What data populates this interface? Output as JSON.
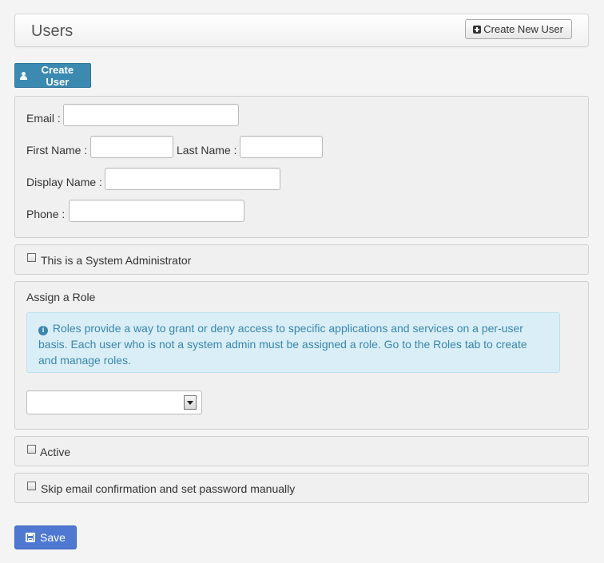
{
  "header": {
    "title": "Users",
    "create_new_label": "Create New User"
  },
  "create_user_label": "Create User",
  "form": {
    "email_label": "Email :",
    "email_value": "",
    "first_name_label": "First Name :",
    "first_name_value": "",
    "last_name_label": "Last Name :",
    "last_name_value": "",
    "display_name_label": "Display Name :",
    "display_name_value": "",
    "phone_label": "Phone :",
    "phone_value": ""
  },
  "system_admin": {
    "label": "This is a System Administrator",
    "checked": false
  },
  "role": {
    "title": "Assign a Role",
    "info_text": "Roles provide a way to grant or deny access to specific applications and services on a per-user basis. Each user who is not a system admin must be assigned a role. Go to the Roles tab to create and manage roles.",
    "selected": ""
  },
  "active": {
    "label": "Active",
    "checked": false
  },
  "skip_email": {
    "label": "Skip email confirmation and set password manually",
    "checked": false
  },
  "save_label": "Save",
  "colors": {
    "create_user_btn": "#3a8ab2",
    "save_btn": "#4e78d2",
    "info_bg": "#d9eef6",
    "info_text": "#3a87ad"
  }
}
